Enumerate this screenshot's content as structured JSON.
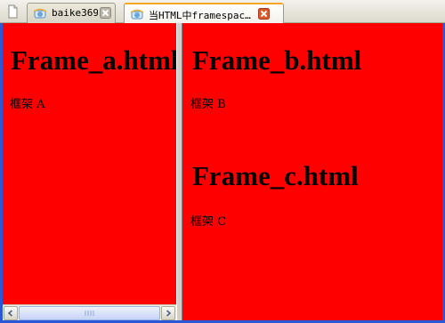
{
  "tabs": [
    {
      "title": "baike369",
      "active": false
    },
    {
      "title": "当HTML中framespac…",
      "active": true
    }
  ],
  "frames": {
    "a": {
      "heading": "Frame_a.html",
      "text": "框架 A"
    },
    "b": {
      "heading": "Frame_b.html",
      "text": "框架 B"
    },
    "c": {
      "heading": "Frame_c.html",
      "text": "框架 C"
    }
  },
  "colors": {
    "frame_background": "#ff0000",
    "window_border": "#2b58d6",
    "active_tab_accent": "#f5a623",
    "close_button": "#e0562b"
  },
  "icons": {
    "new_tab": "page-icon",
    "tab_favicon": "ie-globe-icon",
    "tab_close": "close-icon",
    "scroll_left": "arrow-left-icon",
    "scroll_right": "arrow-right-icon"
  }
}
